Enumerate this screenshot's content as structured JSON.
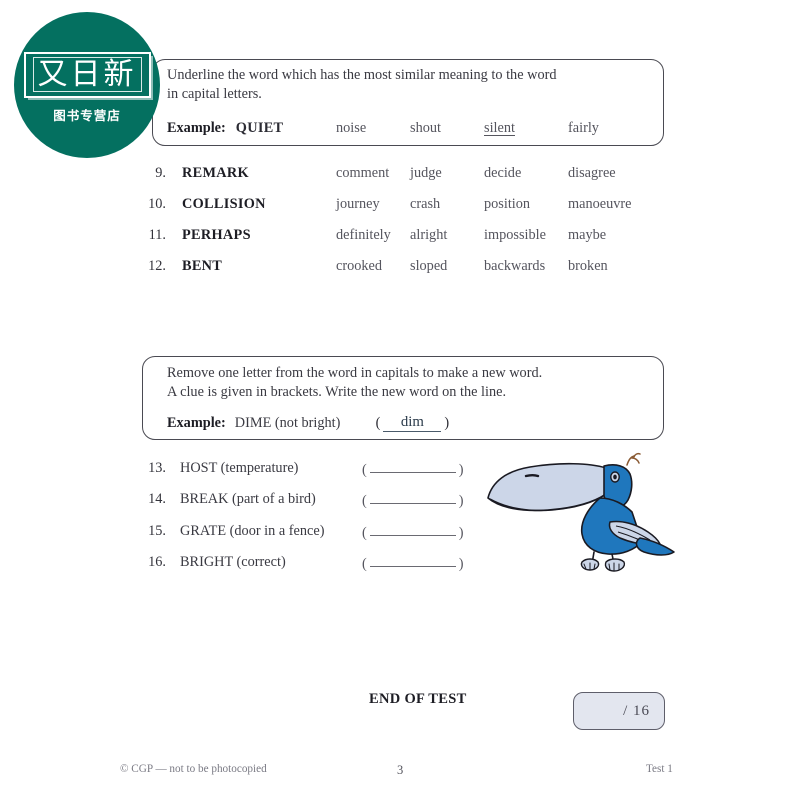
{
  "logo": {
    "main_text": "又日新",
    "sub_text": "图书专营店",
    "color": "#047060"
  },
  "section1": {
    "instruction_line1": "Underline the word which has the most similar meaning to the word",
    "instruction_line2": "in capital letters.",
    "example_label": "Example:",
    "example_word": "QUIET",
    "example_options": [
      "noise",
      "shout",
      "silent",
      "fairly"
    ],
    "example_answer": "silent",
    "questions": [
      {
        "number": "9.",
        "word": "REMARK",
        "options": [
          "comment",
          "judge",
          "decide",
          "disagree"
        ]
      },
      {
        "number": "10.",
        "word": "COLLISION",
        "options": [
          "journey",
          "crash",
          "position",
          "manoeuvre"
        ]
      },
      {
        "number": "11.",
        "word": "PERHAPS",
        "options": [
          "definitely",
          "alright",
          "impossible",
          "maybe"
        ]
      },
      {
        "number": "12.",
        "word": "BENT",
        "options": [
          "crooked",
          "sloped",
          "backwards",
          "broken"
        ]
      }
    ]
  },
  "section2": {
    "instruction_line1": "Remove one letter from the word in capitals to make a new word.",
    "instruction_line2": "A clue is given in brackets.  Write the new word on the line.",
    "example_label": "Example:",
    "example_prompt": "DIME (not bright)",
    "example_open_paren": "(",
    "example_answer": "dim",
    "example_close_paren": ")",
    "questions": [
      {
        "number": "13.",
        "prompt": "HOST (temperature)",
        "open_paren": "(",
        "answer": "",
        "close_paren": ")"
      },
      {
        "number": "14.",
        "prompt": "BREAK (part of a bird)",
        "open_paren": "(",
        "answer": "",
        "close_paren": ")"
      },
      {
        "number": "15.",
        "prompt": "GRATE (door in a fence)",
        "open_paren": "(",
        "answer": "",
        "close_paren": ")"
      },
      {
        "number": "16.",
        "prompt": "BRIGHT (correct)",
        "open_paren": "(",
        "answer": "",
        "close_paren": ")"
      }
    ]
  },
  "illustration": {
    "name": "toucan-bird",
    "body_color": "#1f77bd",
    "beak_color": "#ccd6e8",
    "outline_color": "#1a1a22"
  },
  "footer": {
    "end_of_test": "END OF TEST",
    "score": "/ 16",
    "copyright": "© CGP — not to be photocopied",
    "page_number": "3",
    "test_name": "Test 1"
  }
}
